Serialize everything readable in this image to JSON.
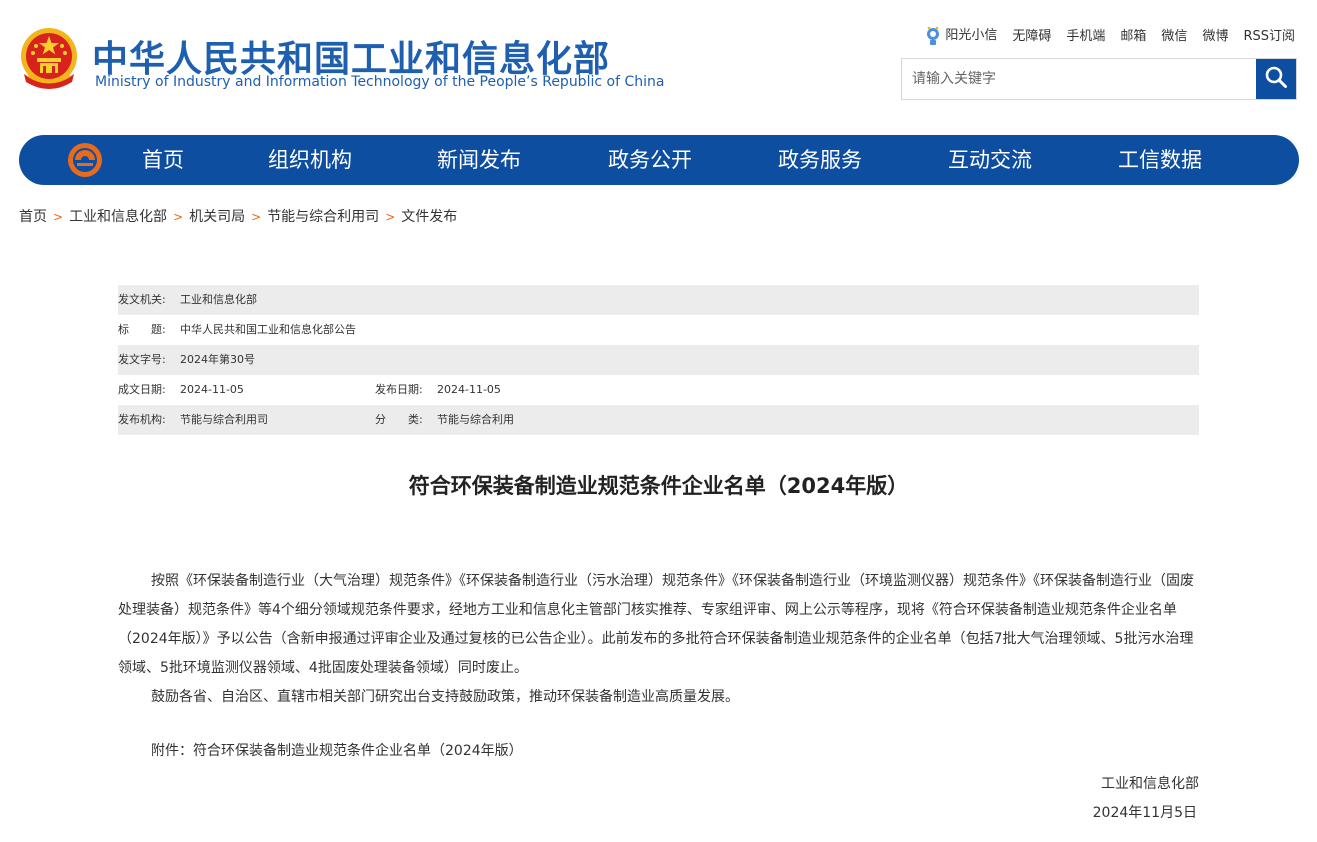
{
  "header": {
    "title_cn": "中华人民共和国工业和信息化部",
    "title_en": "Ministry of Industry and Information Technology of the People’s Republic of China",
    "top_links": [
      "阳光小信",
      "无障碍",
      "手机端",
      "邮箱",
      "微信",
      "微博",
      "RSS订阅"
    ],
    "search_placeholder": "请输入关键字"
  },
  "nav": {
    "items": [
      "首页",
      "组织机构",
      "新闻发布",
      "政务公开",
      "政务服务",
      "互动交流",
      "工信数据"
    ]
  },
  "breadcrumb": [
    "首页",
    "工业和信息化部",
    "机关司局",
    "节能与综合利用司",
    "文件发布"
  ],
  "breadcrumb_sep": ">",
  "info": {
    "issuer_label": "发文机关:",
    "issuer": "工业和信息化部",
    "title_label": "标　　题:",
    "title": "中华人民共和国工业和信息化部公告",
    "docno_label": "发文字号:",
    "docno": "2024年第30号",
    "created_label": "成文日期:",
    "created": "2024-11-05",
    "published_label": "发布日期:",
    "published": "2024-11-05",
    "org_label": "发布机构:",
    "org": "节能与综合利用司",
    "category_label": "分　　类:",
    "category": "节能与综合利用"
  },
  "article": {
    "title": "符合环保装备制造业规范条件企业名单（2024年版）",
    "para1": "按照《环保装备制造行业（大气治理）规范条件》《环保装备制造行业（污水治理）规范条件》《环保装备制造行业（环境监测仪器）规范条件》《环保装备制造行业（固废处理装备）规范条件》等4个细分领域规范条件要求，经地方工业和信息化主管部门核实推荐、专家组评审、网上公示等程序，现将《符合环保装备制造业规范条件企业名单（2024年版）》予以公告（含新申报通过评审企业及通过复核的已公告企业）。此前发布的多批符合环保装备制造业规范条件的企业名单（包括7批大气治理领域、5批污水治理领域、5批环境监测仪器领域、4批固废处理装备领域）同时废止。",
    "para2": "鼓励各省、自治区、直辖市相关部门研究出台支持鼓励政策，推动环保装备制造业高质量发展。",
    "attachment": "附件：符合环保装备制造业规范条件企业名单（2024年版）",
    "sign_org": "工业和信息化部",
    "sign_date": "2024年11月5日"
  },
  "colors": {
    "brand_blue": "#0d4ea1",
    "title_blue": "#1e5fb0",
    "breadcrumb_sep": "#e66a1a",
    "info_row_grey": "#ececec"
  },
  "icons": [
    "national-emblem-icon",
    "sunshine-icon",
    "search-icon",
    "nav-logo-icon"
  ]
}
